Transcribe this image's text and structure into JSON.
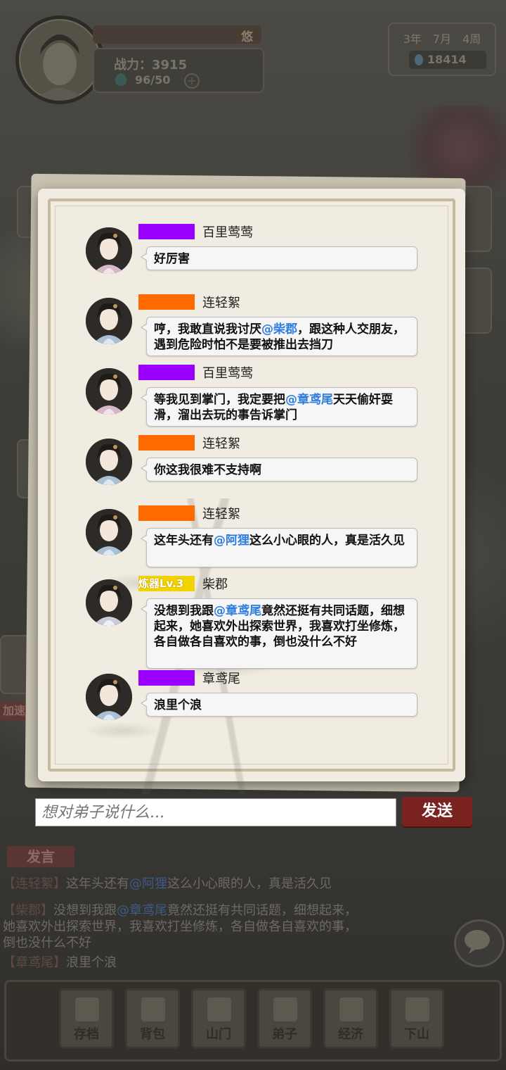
{
  "hud": {
    "player_name": "悠",
    "combat_power": "战力：3915",
    "stamina": "96/50",
    "date": "3年　7月　4周",
    "spirit_stones": "18414",
    "speed_label": "加速"
  },
  "chat_dialog": {
    "messages": [
      {
        "tag_color": "#9b00ff",
        "tag_label": "",
        "sender": "百里莺莺",
        "avatar": "female-avatar-pink",
        "parts": [
          {
            "t": "好厉害"
          }
        ]
      },
      {
        "tag_color": "#ff6a00",
        "tag_label": "",
        "sender": "连轻絮",
        "avatar": "female-avatar-blue",
        "parts": [
          {
            "t": "哼，我敢直说我讨厌"
          },
          {
            "t": "@柴郡",
            "at": true
          },
          {
            "t": "，跟这种人交朋友，遇到危险时怕不是要被推出去挡刀"
          }
        ]
      },
      {
        "tag_color": "#9b00ff",
        "tag_label": "",
        "sender": "百里莺莺",
        "avatar": "female-avatar-pink",
        "parts": [
          {
            "t": "等我见到掌门，我定要把"
          },
          {
            "t": "@章鸢尾",
            "at": true
          },
          {
            "t": "天天偷奸耍滑，溜出去玩的事告诉掌门"
          }
        ]
      },
      {
        "tag_color": "#ff6a00",
        "tag_label": "",
        "sender": "连轻絮",
        "avatar": "female-avatar-blue",
        "parts": [
          {
            "t": "你这我很难不支持啊"
          }
        ]
      },
      {
        "tag_color": "#ff6a00",
        "tag_label": "",
        "sender": "连轻絮",
        "avatar": "female-avatar-blue",
        "parts": [
          {
            "t": "这年头还有"
          },
          {
            "t": "@阿狸",
            "at": true
          },
          {
            "t": "这么小心眼的人，真是活久见"
          }
        ]
      },
      {
        "tag_color": "#f2d300",
        "tag_label": "炼器Lv.3",
        "sender": "柴郡",
        "avatar": "female-avatar-white",
        "parts": [
          {
            "t": "没想到我跟"
          },
          {
            "t": "@章鸢尾",
            "at": true
          },
          {
            "t": "竟然还挺有共同话题，细想起来，她喜欢外出探索世界，我喜欢打坐修炼，各自做各自喜欢的事，倒也没什么不好"
          }
        ]
      },
      {
        "tag_color": "#9b00ff",
        "tag_label": "",
        "sender": "章鸢尾",
        "avatar": "female-avatar-blue",
        "parts": [
          {
            "t": "浪里个浪"
          }
        ]
      }
    ],
    "input_placeholder": "想对弟子说什么...",
    "send_label": "发送"
  },
  "background_chat": {
    "speak_tab": "发言",
    "lines": [
      {
        "name": "【连轻絮】",
        "parts": [
          {
            "t": "这年头还有"
          },
          {
            "t": "@阿狸",
            "at": true
          },
          {
            "t": "这么小心眼的人，真是活久见"
          }
        ]
      },
      {
        "name": "【柴郡】",
        "parts": [
          {
            "t": "没想到我跟"
          },
          {
            "t": "@章鸢尾",
            "at": true
          },
          {
            "t": "竟然还挺有共同话题，细想起来，她喜欢外出探索世界，我喜欢打坐修炼，各自做各自喜欢的事，倒也没什么不好"
          }
        ]
      },
      {
        "name": "【章鸢尾】",
        "parts": [
          {
            "t": "浪里个浪"
          }
        ]
      }
    ]
  },
  "bottom_nav": [
    {
      "label": "存档",
      "icon": "book-icon"
    },
    {
      "label": "背包",
      "icon": "bag-icon"
    },
    {
      "label": "山门",
      "icon": "gate-icon"
    },
    {
      "label": "弟子",
      "icon": "disciple-icon"
    },
    {
      "label": "经济",
      "icon": "coins-icon"
    },
    {
      "label": "下山",
      "icon": "mountain-icon"
    }
  ]
}
